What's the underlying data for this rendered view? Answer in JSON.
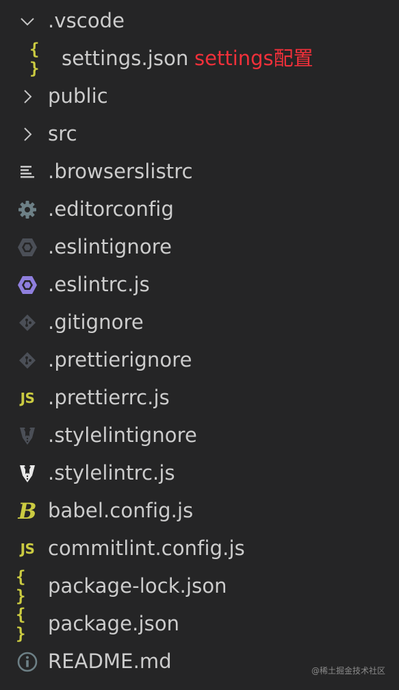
{
  "explorer": {
    "items": [
      {
        "name": ".vscode",
        "icon": "chevron-down-icon",
        "level": 0
      },
      {
        "name": "settings.json",
        "icon": "json-icon",
        "level": 1,
        "note": "settings配置"
      },
      {
        "name": "public",
        "icon": "chevron-right-icon",
        "level": 0
      },
      {
        "name": "src",
        "icon": "chevron-right-icon",
        "level": 0
      },
      {
        "name": ".browserslistrc",
        "icon": "lines-icon",
        "level": 0
      },
      {
        "name": ".editorconfig",
        "icon": "gear-icon",
        "level": 0
      },
      {
        "name": ".eslintignore",
        "icon": "eslint-hexagon-icon",
        "level": 0
      },
      {
        "name": ".eslintrc.js",
        "icon": "eslint-hexagon-icon",
        "level": 0
      },
      {
        "name": ".gitignore",
        "icon": "git-diamond-icon",
        "level": 0
      },
      {
        "name": ".prettierignore",
        "icon": "git-diamond-icon",
        "level": 0
      },
      {
        "name": ".prettierrc.js",
        "icon": "js-icon",
        "level": 0
      },
      {
        "name": ".stylelintignore",
        "icon": "tuxedo-icon",
        "level": 0
      },
      {
        "name": ".stylelintrc.js",
        "icon": "tuxedo-icon",
        "level": 0
      },
      {
        "name": "babel.config.js",
        "icon": "babel-icon",
        "level": 0
      },
      {
        "name": "commitlint.config.js",
        "icon": "js-icon",
        "level": 0
      },
      {
        "name": "package-lock.json",
        "icon": "json-icon",
        "level": 0
      },
      {
        "name": "package.json",
        "icon": "json-icon",
        "level": 0
      },
      {
        "name": "README.md",
        "icon": "info-icon",
        "level": 0
      }
    ]
  },
  "icon_glyphs": {
    "js": "JS",
    "json": "{ }",
    "babel": "B"
  },
  "colors": {
    "background": "#252526",
    "text": "#cccccc",
    "annotation": "#f0303a",
    "yellow": "#cbcb41",
    "gray_icon": "#6d8086",
    "eslint_dim": "#4b4f57",
    "eslint_purple": "#8f7fdd"
  },
  "watermark": "@稀土掘金技术社区"
}
